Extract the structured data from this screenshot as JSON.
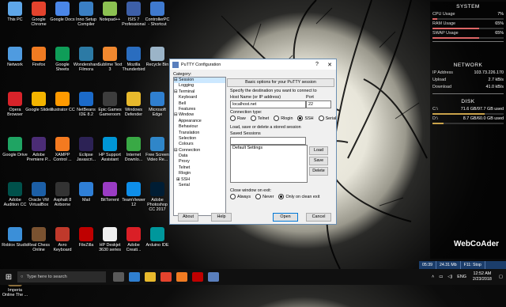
{
  "desktop_icons": [
    {
      "label": "This PC",
      "color": "#5ea6e8"
    },
    {
      "label": "Google Chrome",
      "color": "#e4432d"
    },
    {
      "label": "Google Docs",
      "color": "#4a86e8"
    },
    {
      "label": "Inno Setup Compiler",
      "color": "#3a7fc4"
    },
    {
      "label": "Notepad++",
      "color": "#8cc152"
    },
    {
      "label": "ISIS 7 Professional",
      "color": "#3d5fa8"
    },
    {
      "label": "ControllerPC - Shortcut",
      "color": "#3f7ad0"
    },
    {
      "label": "Network",
      "color": "#4f9be0"
    },
    {
      "label": "Firefox",
      "color": "#f07b22"
    },
    {
      "label": "Google Sheets",
      "color": "#0f9d58"
    },
    {
      "label": "Wondershare Filmora",
      "color": "#2c7aa5"
    },
    {
      "label": "Sublime Text 3",
      "color": "#f0882f"
    },
    {
      "label": "Mozilla Thunderbird",
      "color": "#2a6dbf"
    },
    {
      "label": "Recycle Bin",
      "color": "#9bb4c8"
    },
    {
      "label": "Opera Browser",
      "color": "#d8232a"
    },
    {
      "label": "Google Slides",
      "color": "#f4b400"
    },
    {
      "label": "Illustrator CC",
      "color": "#ff9a00"
    },
    {
      "label": "NetBeans IDE 8.2",
      "color": "#1b6ac9"
    },
    {
      "label": "Epic Games Gameroom",
      "color": "#3d3d3d"
    },
    {
      "label": "Windows Defender",
      "color": "#e8b92c"
    },
    {
      "label": "Microsoft Edge",
      "color": "#2f7fd0"
    },
    {
      "label": "Google Drive",
      "color": "#1fa463"
    },
    {
      "label": "Adobe Premiere P...",
      "color": "#4b2c75"
    },
    {
      "label": "XAMPP Control ...",
      "color": "#f47a20"
    },
    {
      "label": "Eclipse Javascri...",
      "color": "#2c2255"
    },
    {
      "label": "HP Support Assistant",
      "color": "#0096d6"
    },
    {
      "label": "Internet Downlo...",
      "color": "#39a945"
    },
    {
      "label": "Free Screen Video Re...",
      "color": "#2f86c9"
    },
    {
      "label": "Adobe Audition CC",
      "color": "#00514b"
    },
    {
      "label": "Oracle VM VirtualBox",
      "color": "#1c5fa6"
    },
    {
      "label": "Asphalt 8 Airborne",
      "color": "#333333"
    },
    {
      "label": "Mail",
      "color": "#2f7fd6"
    },
    {
      "label": "BitTorrent",
      "color": "#9a3cc4"
    },
    {
      "label": "TeamViewer 12",
      "color": "#0e8ee9"
    },
    {
      "label": "Adobe Photoshop CC 2017",
      "color": "#001d34"
    },
    {
      "label": "Roblox Studio",
      "color": "#3b8fd8"
    },
    {
      "label": "Real Chess Online",
      "color": "#7a5230"
    },
    {
      "label": "Avro Keyboard",
      "color": "#c0392b"
    },
    {
      "label": "FileZilla",
      "color": "#bf0000"
    },
    {
      "label": "HP Deskjet 3630 series",
      "color": "#eeeeee"
    },
    {
      "label": "Adobe Creati...",
      "color": "#da1f26"
    },
    {
      "label": "Arduino IDE",
      "color": "#00979c"
    },
    {
      "label": "Imperia Online The ...",
      "color": "#8a6d3b"
    }
  ],
  "monitor": {
    "system_title": "SYSTEM",
    "system": [
      {
        "k": "CPU Usage",
        "v": "7%",
        "pct": 7
      },
      {
        "k": "RAM Usage",
        "v": "65%",
        "pct": 65
      },
      {
        "k": "SWAP Usage",
        "v": "65%",
        "pct": 65
      }
    ],
    "network_title": "NETWORK",
    "network": [
      {
        "k": "IP Address",
        "v": "103.73.226.170"
      },
      {
        "k": "Upload",
        "v": "2.7 kB/s"
      },
      {
        "k": "Download",
        "v": "41.0 kB/s"
      }
    ],
    "disk_title": "DISK",
    "disk": [
      {
        "k": "C:\\",
        "v": "71.6 GB/97.7 GB used",
        "pct": 73
      },
      {
        "k": "D:\\",
        "v": "8.7 GB/60.0 GB used",
        "pct": 15
      }
    ]
  },
  "putty": {
    "title": "PuTTY Configuration",
    "help": "?",
    "close": "✕",
    "category_label": "Category:",
    "tree": [
      "⊟ Session",
      "    Logging",
      "⊟ Terminal",
      "    Keyboard",
      "    Bell",
      "    Features",
      "⊟ Window",
      "    Appearance",
      "    Behaviour",
      "    Translation",
      "    Selection",
      "    Colours",
      "⊟ Connection",
      "    Data",
      "    Proxy",
      "    Telnet",
      "    Rlogin",
      "  ⊞ SSH",
      "    Serial"
    ],
    "header_button": "Basic options for your PuTTY session",
    "dest_label": "Specify the destination you want to connect to",
    "host_label": "Host Name (or IP address)",
    "port_label": "Port",
    "host_value": "localhost.net",
    "port_value": "22",
    "conn_type_label": "Connection type:",
    "conn_types": [
      {
        "label": "Raw",
        "on": false
      },
      {
        "label": "Telnet",
        "on": false
      },
      {
        "label": "Rlogin",
        "on": false
      },
      {
        "label": "SSH",
        "on": true
      },
      {
        "label": "Serial",
        "on": false
      }
    ],
    "sessions_title": "Load, save or delete a stored session",
    "saved_label": "Saved Sessions",
    "saved_value": "",
    "sessions_list": [
      "Default Settings"
    ],
    "load": "Load",
    "save": "Save",
    "delete": "Delete",
    "close_exit_label": "Close window on exit:",
    "exit_opts": [
      {
        "label": "Always",
        "on": false
      },
      {
        "label": "Never",
        "on": false
      },
      {
        "label": "Only on clean exit",
        "on": true
      }
    ],
    "about": "About",
    "help_btn": "Help",
    "open": "Open",
    "cancel": "Cancel"
  },
  "taskbar": {
    "search_placeholder": "Type here to search",
    "pinned": [
      "#5a5a5a",
      "#2f7fd0",
      "#e8b92c",
      "#e4432d",
      "#f07b22",
      "#bf0000",
      "#5a7fbd"
    ],
    "lang": "ENG",
    "time": "12:52 AM",
    "date": "2/23/2018"
  },
  "perf": [
    "05:39",
    "24.31 Mb",
    "F11: Stop"
  ],
  "watermark": "WebCoAder"
}
